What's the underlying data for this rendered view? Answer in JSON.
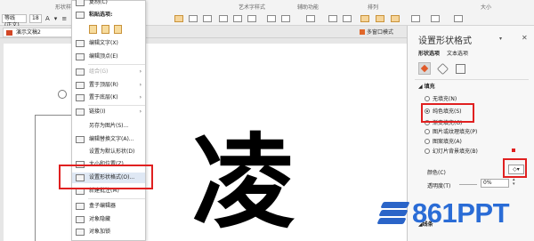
{
  "ribbon": {
    "groups": [
      "形状样式",
      "艺术字样式",
      "辅助功能",
      "排列",
      "大小"
    ],
    "font_name": "等线 (正文)",
    "font_size": "18"
  },
  "tabs": {
    "document": "演示文稿2",
    "multi_window": "多窗口模式"
  },
  "slide": {
    "big_char": "凌"
  },
  "context_menu": {
    "items": [
      {
        "label": "复制(C)",
        "disabled": false
      },
      {
        "label": "粘贴选项:",
        "disabled": false
      },
      {
        "label": "编辑文字(X)",
        "disabled": false
      },
      {
        "label": "编辑顶点(E)",
        "disabled": false
      },
      {
        "label": "组合(G)",
        "disabled": true
      },
      {
        "label": "置于顶层(R)",
        "disabled": false
      },
      {
        "label": "置于底层(K)",
        "disabled": false
      },
      {
        "label": "链接(I)",
        "disabled": false
      },
      {
        "label": "另存为图片(S)...",
        "disabled": false
      },
      {
        "label": "编辑替换文字(A)...",
        "disabled": false
      },
      {
        "label": "设置为默认形状(D)",
        "disabled": false
      },
      {
        "label": "大小和位置(Z)...",
        "disabled": false
      },
      {
        "label": "设置形状格式(O)...",
        "disabled": false
      },
      {
        "label": "新建批注(M)",
        "disabled": false
      },
      {
        "label": "盒子编辑器",
        "disabled": false
      },
      {
        "label": "对象隐藏",
        "disabled": false
      },
      {
        "label": "对象加锁",
        "disabled": false
      }
    ]
  },
  "format_pane": {
    "title": "设置形状格式",
    "tabs": [
      "形状选项",
      "文本选项"
    ],
    "section_fill": "填充",
    "fill_options": [
      {
        "label": "无填充(N)",
        "selected": false
      },
      {
        "label": "纯色填充(S)",
        "selected": true
      },
      {
        "label": "渐变填充(G)",
        "selected": false
      },
      {
        "label": "图片或纹理填充(P)",
        "selected": false
      },
      {
        "label": "图案填充(A)",
        "selected": false
      },
      {
        "label": "幻灯片背景填充(B)",
        "selected": false
      }
    ],
    "color_label": "颜色(C)",
    "transparency_label": "透明度(T)",
    "transparency_value": "0%",
    "section_line": "线条"
  },
  "watermark": {
    "text": "861PPT"
  },
  "colors": {
    "highlight_red": "#e02020",
    "watermark_blue": "#2a6cd6",
    "ppt_orange": "#d24726"
  }
}
